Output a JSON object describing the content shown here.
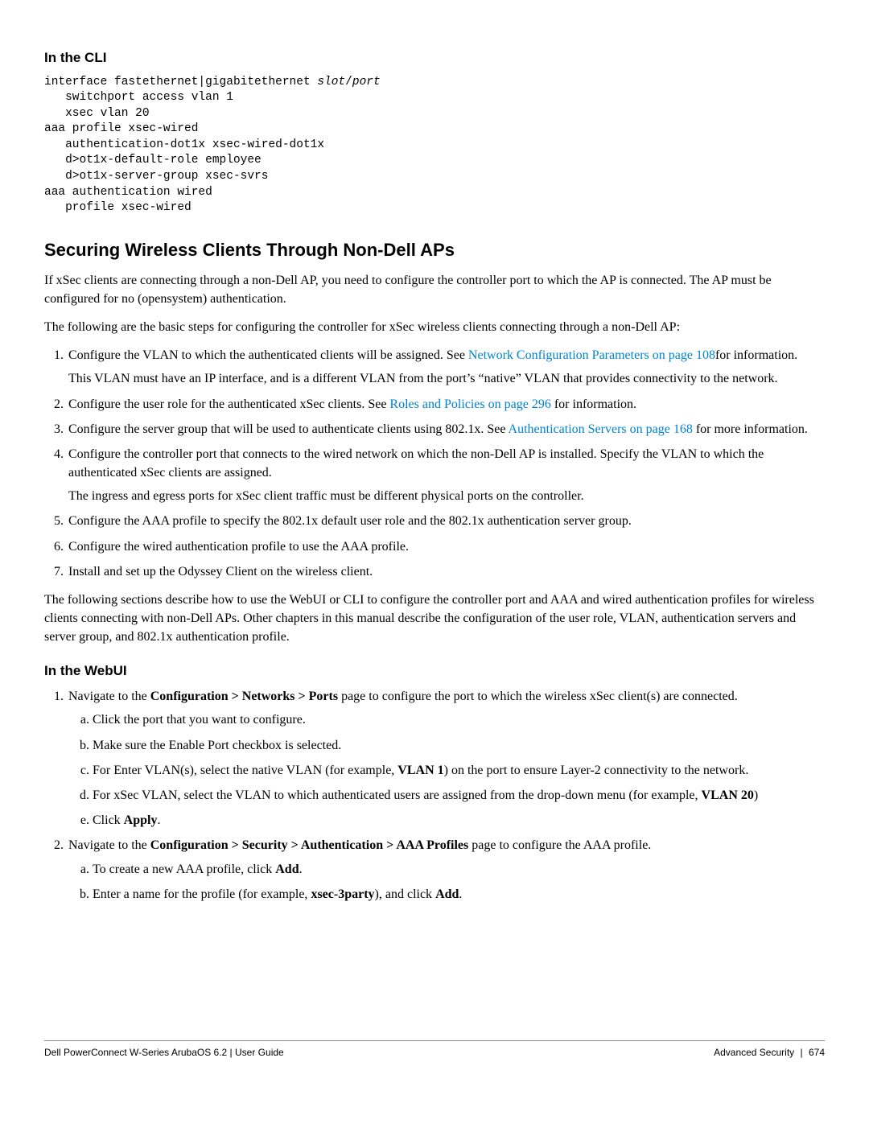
{
  "sections": {
    "cli": {
      "heading": "In the CLI",
      "code_pre": "interface fastethernet|gigabitethernet ",
      "code_arg1": "slot",
      "code_mid": "/",
      "code_arg2": "port",
      "code_rest": "\n   switchport access vlan 1\n   xsec vlan 20\naaa profile xsec-wired\n   authentication-dot1x xsec-wired-dot1x\n   d>ot1x-default-role employee\n   d>ot1x-server-group xsec-svrs\naaa authentication wired\n   profile xsec-wired"
    },
    "securing": {
      "heading": "Securing Wireless Clients Through Non-Dell APs",
      "p1": "If xSec clients are connecting through a non-Dell AP, you need to configure the controller port to which the AP is connected. The AP must be configured for no (opensystem) authentication.",
      "p2": "The following are the basic steps for configuring the controller for xSec wireless clients connecting through a non-Dell AP:",
      "list": [
        {
          "text_a": "Configure the VLAN to which the authenticated clients will be assigned. See ",
          "link": "Network Configuration Parameters on page 108",
          "text_b": "for information.",
          "sub": "This VLAN must have an IP interface, and is a different VLAN from the port’s “native” VLAN that provides connectivity to the network."
        },
        {
          "text_a": "Configure the user role for the authenticated xSec clients. See ",
          "link": "Roles and Policies on page 296",
          "text_b": " for information."
        },
        {
          "text_a": "Configure the server group that will be used to authenticate clients using 802.1x. See ",
          "link": "Authentication Servers on page 168",
          "text_b": " for more information."
        },
        {
          "text_a": "Configure the controller port that connects to the wired network on which the non-Dell AP is installed. Specify the VLAN to which the authenticated xSec clients are assigned.",
          "sub": "The ingress and egress ports for xSec client traffic must be different physical ports on the controller."
        },
        {
          "text_a": "Configure the AAA profile to specify the 802.1x default user role and the 802.1x authentication server group."
        },
        {
          "text_a": "Configure the wired authentication profile to use the AAA profile."
        },
        {
          "text_a": "Install and set up the Odyssey Client on the wireless client."
        }
      ],
      "p3": "The following sections describe how to use the WebUI or CLI to configure the controller port and AAA and wired authentication profiles for wireless clients connecting with non-Dell APs. Other chapters in this manual describe the configuration of the user role, VLAN, authentication servers and server group, and 802.1x authentication profile."
    },
    "webui": {
      "heading": "In the WebUI",
      "step1": {
        "pre": "Navigate to the ",
        "bold": "Configuration > Networks > Ports",
        "post": " page to configure the port to which the wireless xSec client(s) are connected.",
        "a": "Click the port that you want to configure.",
        "b": "Make sure the Enable Port checkbox is selected.",
        "c_pre": "For Enter VLAN(s), select the native VLAN (for example, ",
        "c_bold": "VLAN 1",
        "c_post": ") on the port to ensure Layer-2 connectivity to the network.",
        "d_pre": "For xSec VLAN, select the VLAN to which authenticated users are assigned from the drop-down menu (for example, ",
        "d_bold": "VLAN 20",
        "d_post": ")",
        "e_pre": "Click ",
        "e_bold": "Apply",
        "e_post": "."
      },
      "step2": {
        "pre": "Navigate to the ",
        "bold": "Configuration > Security > Authentication > AAA Profiles",
        "post": " page to configure the AAA profile.",
        "a_pre": "To create a new AAA profile, click ",
        "a_bold": "Add",
        "a_post": ".",
        "b_pre": "Enter a name for the profile (for example, ",
        "b_bold": "xsec-3party",
        "b_post": "), and click ",
        "b_bold2": "Add",
        "b_post2": "."
      }
    }
  },
  "footer": {
    "left_a": "Dell PowerConnect W-Series ArubaOS 6.2",
    "left_sep": "   |   ",
    "left_b": "User Guide",
    "right_a": "Advanced Security",
    "right_sep": "|",
    "right_b": "674"
  }
}
